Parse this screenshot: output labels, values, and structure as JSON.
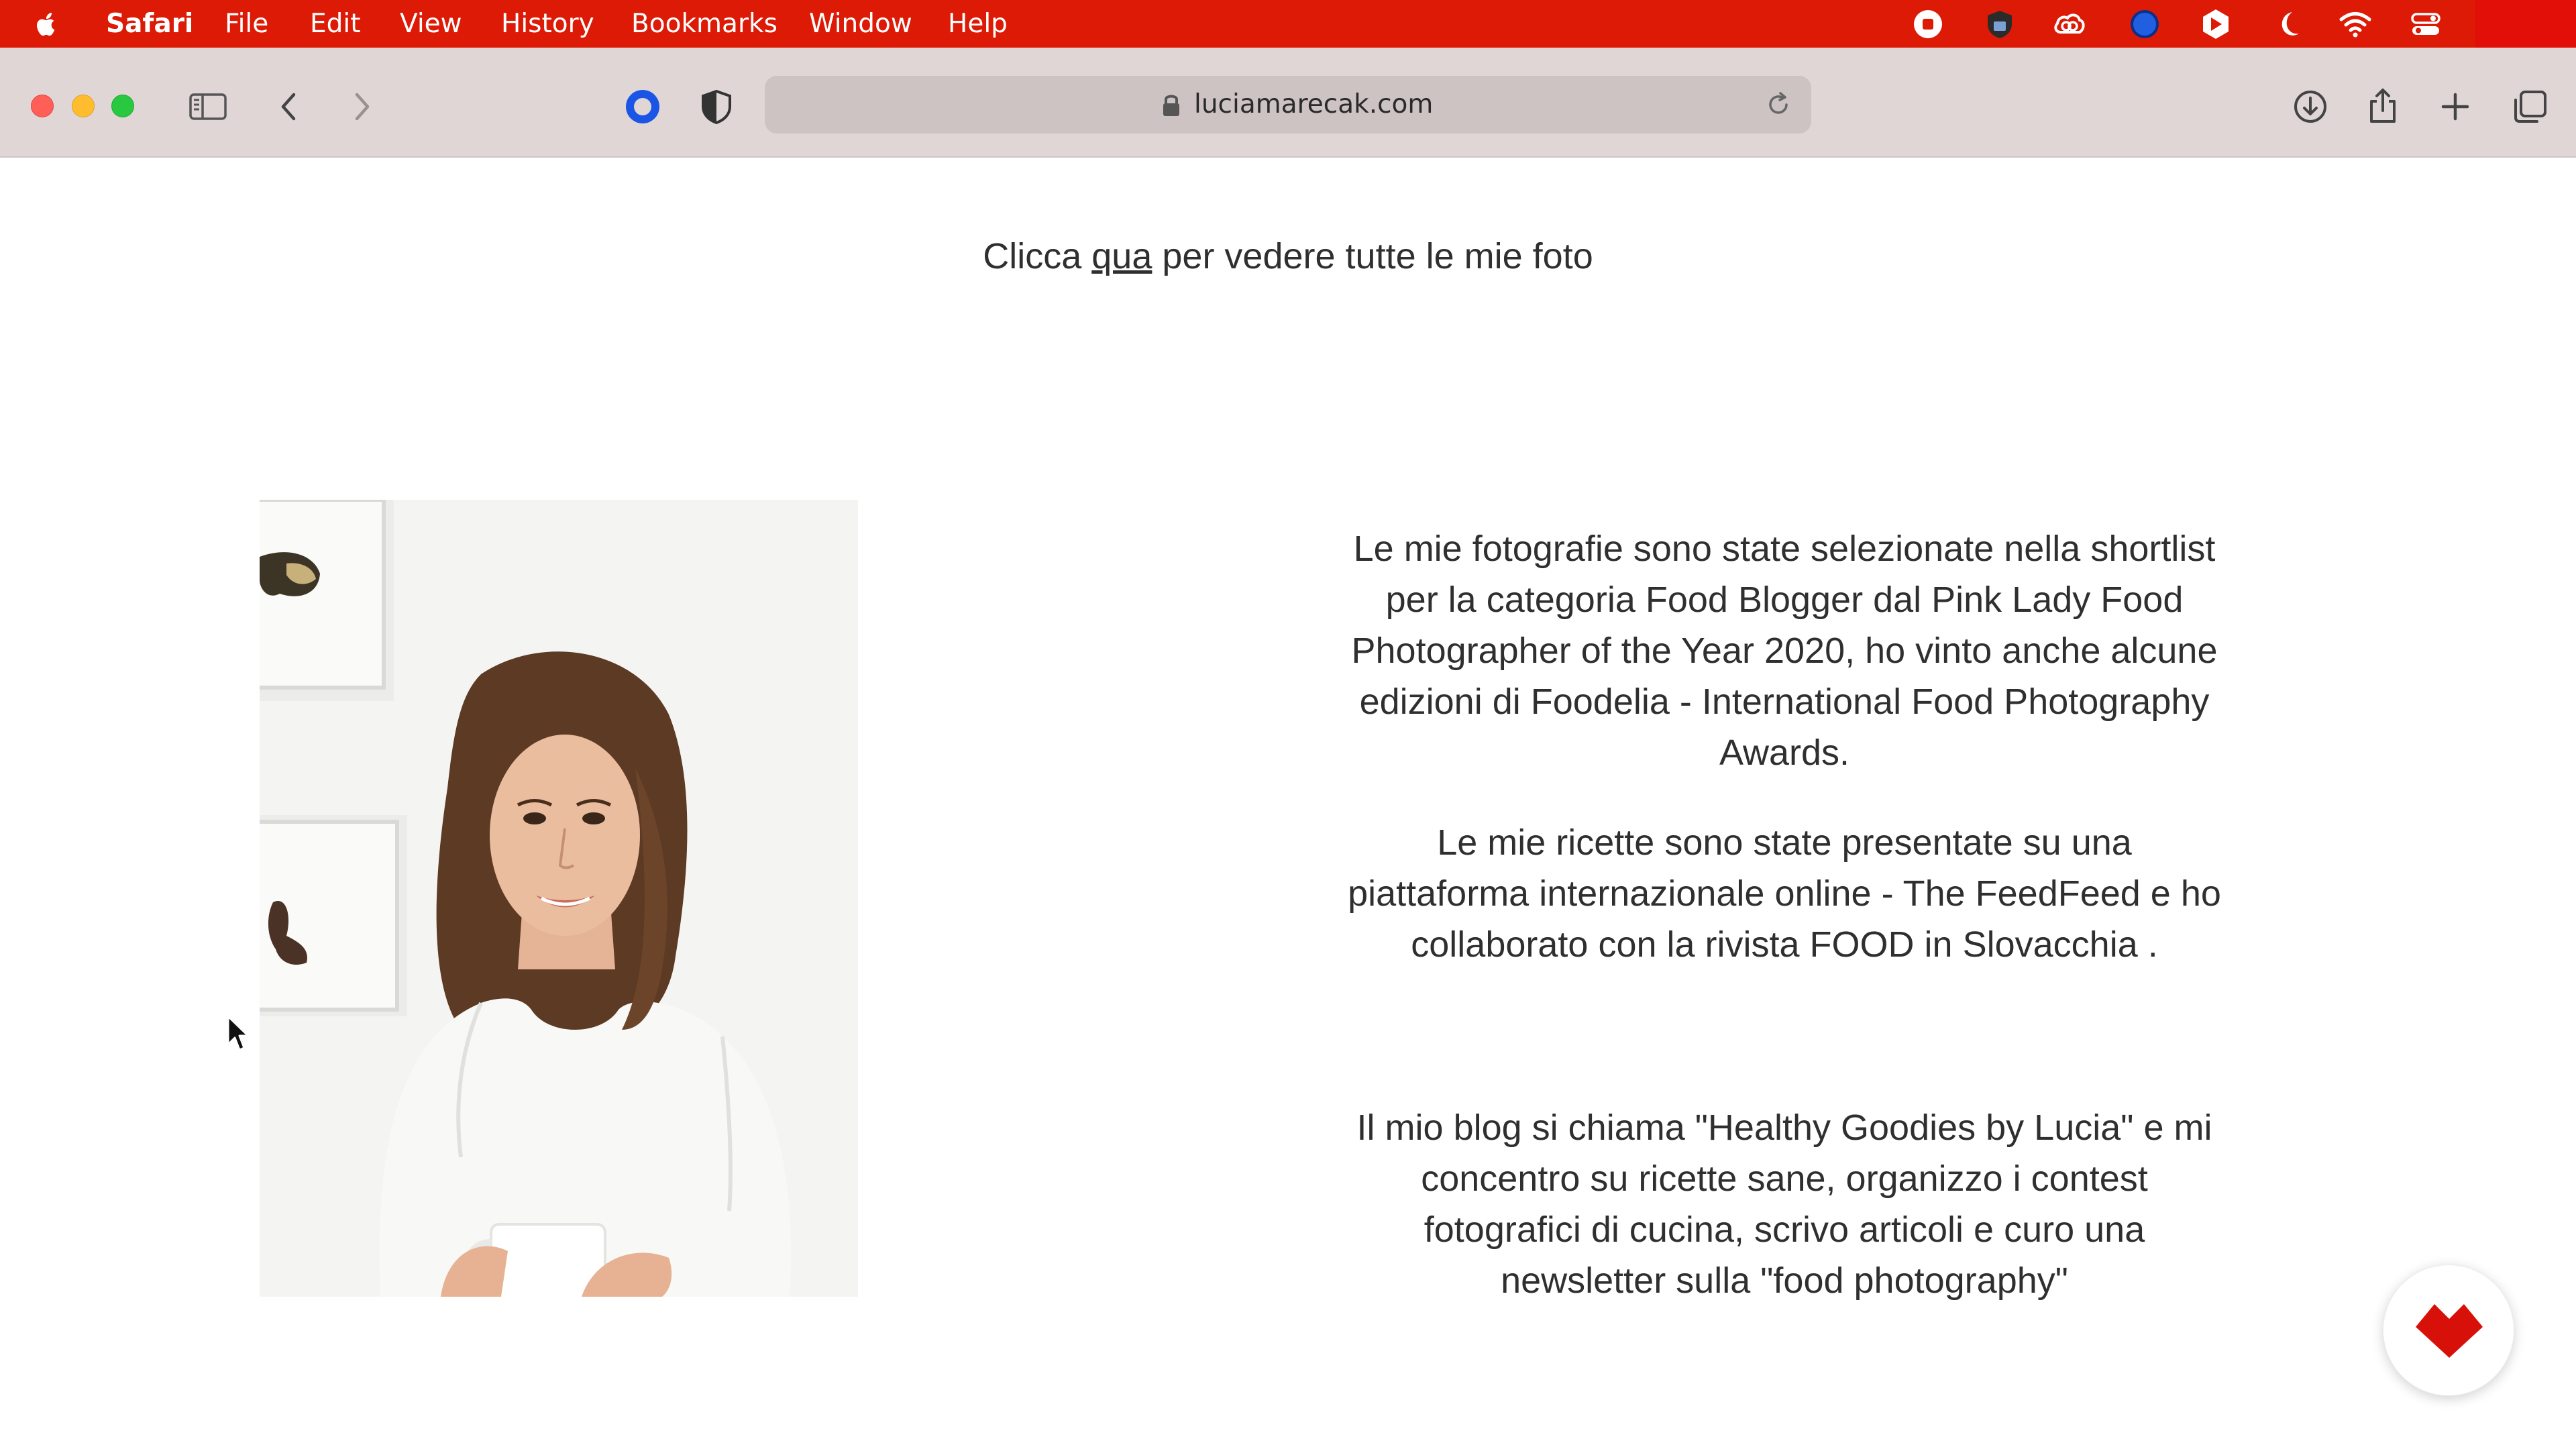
{
  "menubar": {
    "app_name": "Safari",
    "items": [
      "File",
      "Edit",
      "View",
      "History",
      "Bookmarks",
      "Window",
      "Help"
    ],
    "status_icons": [
      "record-icon",
      "shield-extension-icon",
      "creative-cloud-icon",
      "blue-circle-icon",
      "hex-extension-icon",
      "moon-icon",
      "wifi-icon",
      "control-center-icon"
    ],
    "bar_color": "#dc1a06"
  },
  "toolbar": {
    "url": "luciamarecak.com",
    "icons": [
      "sidebar-icon",
      "back-icon",
      "forward-icon",
      "extension-circle-icon",
      "privacy-shield-icon",
      "lock-icon",
      "reload-icon",
      "download-icon",
      "share-icon",
      "new-tab-icon",
      "tab-overview-icon"
    ]
  },
  "content": {
    "top_line": {
      "before": "Clicca ",
      "link": "qua",
      "after": " per vedere tutte le mie foto"
    },
    "photo_alt": "Portrait of Lucia holding a white mug",
    "bio": [
      "Le mie fotografie sono state selezionate nella shortlist per la categoria Food Blogger dal Pink Lady Food Photographer of the Year 2020, ho vinto anche alcune edizioni di Foodelia - International Food Photography Awards.",
      "Le mie ricette sono state presentate su una piattaforma internazionale online - The FeedFeed e ho collaborato con la rivista FOOD in Slovacchia .",
      "Il mio blog si chiama \"Healthy Goodies by Lucia\" e mi concentro su ricette sane, organizzo i contest fotografici di cucina, scrivo articoli e curo una newsletter sulla \"food photography\""
    ],
    "fab_icon": "heart-logo-icon",
    "accent_color": "#dc1a06"
  }
}
